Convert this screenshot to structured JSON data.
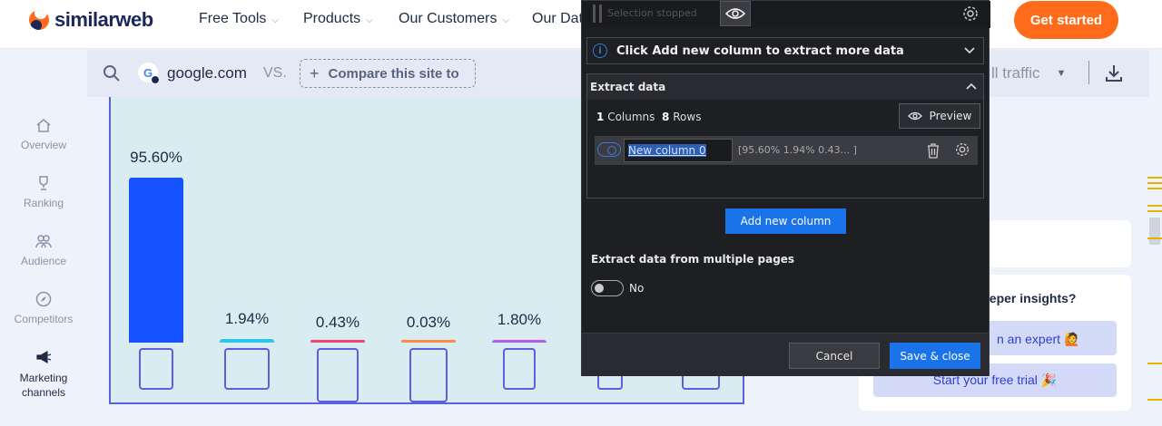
{
  "nav": {
    "logo_text": "similarweb",
    "items": [
      "Free Tools",
      "Products",
      "Our Customers",
      "Our Data"
    ],
    "cta": "Get started"
  },
  "compare_bar": {
    "favicon_letter": "G",
    "domain": "google.com",
    "vs": "VS.",
    "compare_label": "Compare this site to",
    "traffic_label": "ll traffic"
  },
  "sidebar": {
    "items": [
      {
        "label": "Overview",
        "icon": "home-icon"
      },
      {
        "label": "Ranking",
        "icon": "trophy-icon"
      },
      {
        "label": "Audience",
        "icon": "people-icon"
      },
      {
        "label": "Competitors",
        "icon": "compass-icon"
      },
      {
        "label": "Marketing channels",
        "icon": "megaphone-icon"
      }
    ]
  },
  "chart_data": {
    "type": "bar",
    "categories": [
      "",
      "",
      "",
      "",
      "",
      "",
      ""
    ],
    "values": [
      95.6,
      1.94,
      0.43,
      0.03,
      1.8
    ],
    "value_labels": [
      "95.60%",
      "1.94%",
      "0.43%",
      "0.03%",
      "1.80%"
    ],
    "colors": [
      "#1652ff",
      "#2ac7e8",
      "#ef476f",
      "#ff8a3d",
      "#b05cf2"
    ]
  },
  "right_cards": {
    "deeper": "eeper insights?",
    "expert": "n an expert 🙋",
    "trial": "Start your free trial 🎉"
  },
  "dialog": {
    "selection_status": "Selection stopped",
    "banner": "Click Add new column to extract more data",
    "section_title": "Extract data",
    "columns_count": "1",
    "columns_word": "Columns",
    "rows_count": "8",
    "rows_word": "Rows",
    "preview_label": "Preview",
    "column_name": "New column 0",
    "column_preview": "[95.60% 1.94% 0.43...   ]",
    "add_column": "Add new column",
    "multi_pages_label": "Extract data from multiple pages",
    "multi_pages_value": "No",
    "cancel": "Cancel",
    "save": "Save & close"
  }
}
